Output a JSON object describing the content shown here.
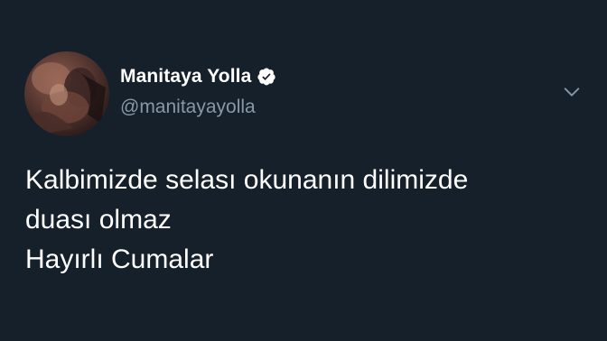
{
  "tweet": {
    "author": {
      "display_name": "Manitaya Yolla",
      "handle": "@manitayayolla",
      "verified": true,
      "avatar_icon": "profile-photo"
    },
    "text_lines": [
      "Kalbimizde selası okunanın dilimizde",
      "duası olmaz",
      "Hayırlı Cumalar"
    ],
    "menu_icon": "chevron-down-icon"
  },
  "colors": {
    "background": "#15202b",
    "text": "#ffffff",
    "secondary_text": "#8899a6",
    "verified_badge": "#ffffff"
  }
}
